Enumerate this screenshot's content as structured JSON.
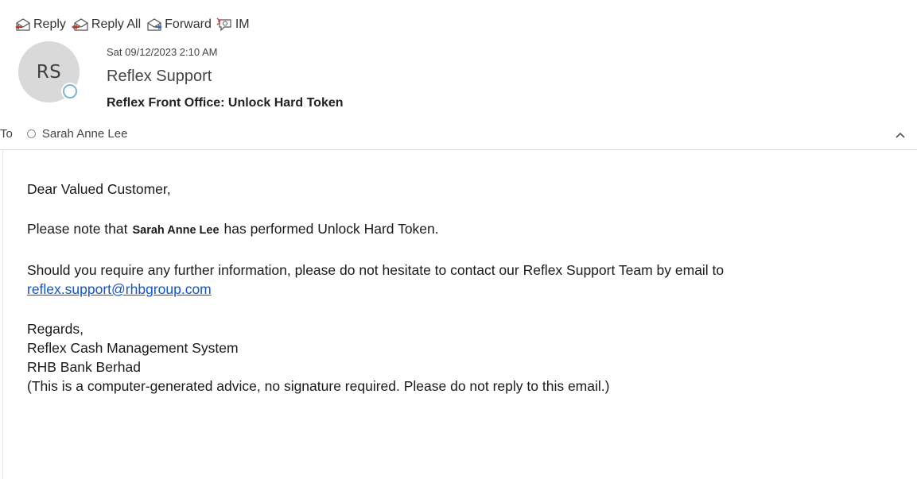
{
  "toolbar": {
    "reply": "Reply",
    "reply_all": "Reply All",
    "forward": "Forward",
    "im": "IM"
  },
  "header": {
    "avatar_initials": "RS",
    "date": "Sat 09/12/2023 2:10 AM",
    "sender": "Reflex Support",
    "subject": "Reflex Front Office: Unlock Hard Token",
    "to_label": "To",
    "recipient": "Sarah Anne Lee"
  },
  "body": {
    "greeting": "Dear Valued Customer,",
    "line1_prefix": "Please note that",
    "line1_name": "Sarah Anne Lee",
    "line1_suffix": "has performed Unlock Hard Token.",
    "line2": "Should you require any further information, please do not hesitate to contact our Reflex Support Team by email to",
    "email_link": "reflex.support@rhbgroup.com",
    "regards": "Regards,",
    "sig1": "Reflex Cash Management System",
    "sig2": "RHB Bank Berhad",
    "disclaimer": "(This is a computer-generated advice, no signature required. Please do not reply to this email.)"
  },
  "icons": {
    "reply": "reply-icon",
    "reply_all": "reply-all-icon",
    "forward": "forward-icon",
    "im": "im-icon",
    "presence": "presence-status-icon",
    "recipient_status": "recipient-status-icon",
    "collapse": "chevron-up-icon"
  },
  "colors": {
    "link": "#1155cc",
    "avatar_bg": "#d9d9d9",
    "presence_ring": "#7fb3c9",
    "icon_blue": "#3a6fb5",
    "icon_red": "#c0392b"
  }
}
